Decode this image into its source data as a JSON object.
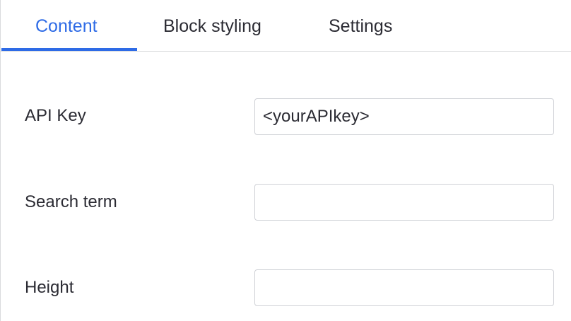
{
  "tabs": [
    {
      "label": "Content",
      "active": true
    },
    {
      "label": "Block styling",
      "active": false
    },
    {
      "label": "Settings",
      "active": false
    }
  ],
  "fields": {
    "api_key": {
      "label": "API Key",
      "value": "<yourAPIkey>",
      "placeholder": ""
    },
    "search_term": {
      "label": "Search term",
      "value": "",
      "placeholder": ""
    },
    "height": {
      "label": "Height",
      "value": "",
      "placeholder": ""
    }
  },
  "colors": {
    "accent": "#2e6be6",
    "text": "#2b2b33",
    "border": "#cfd1d6",
    "divider": "#d9dadd"
  }
}
